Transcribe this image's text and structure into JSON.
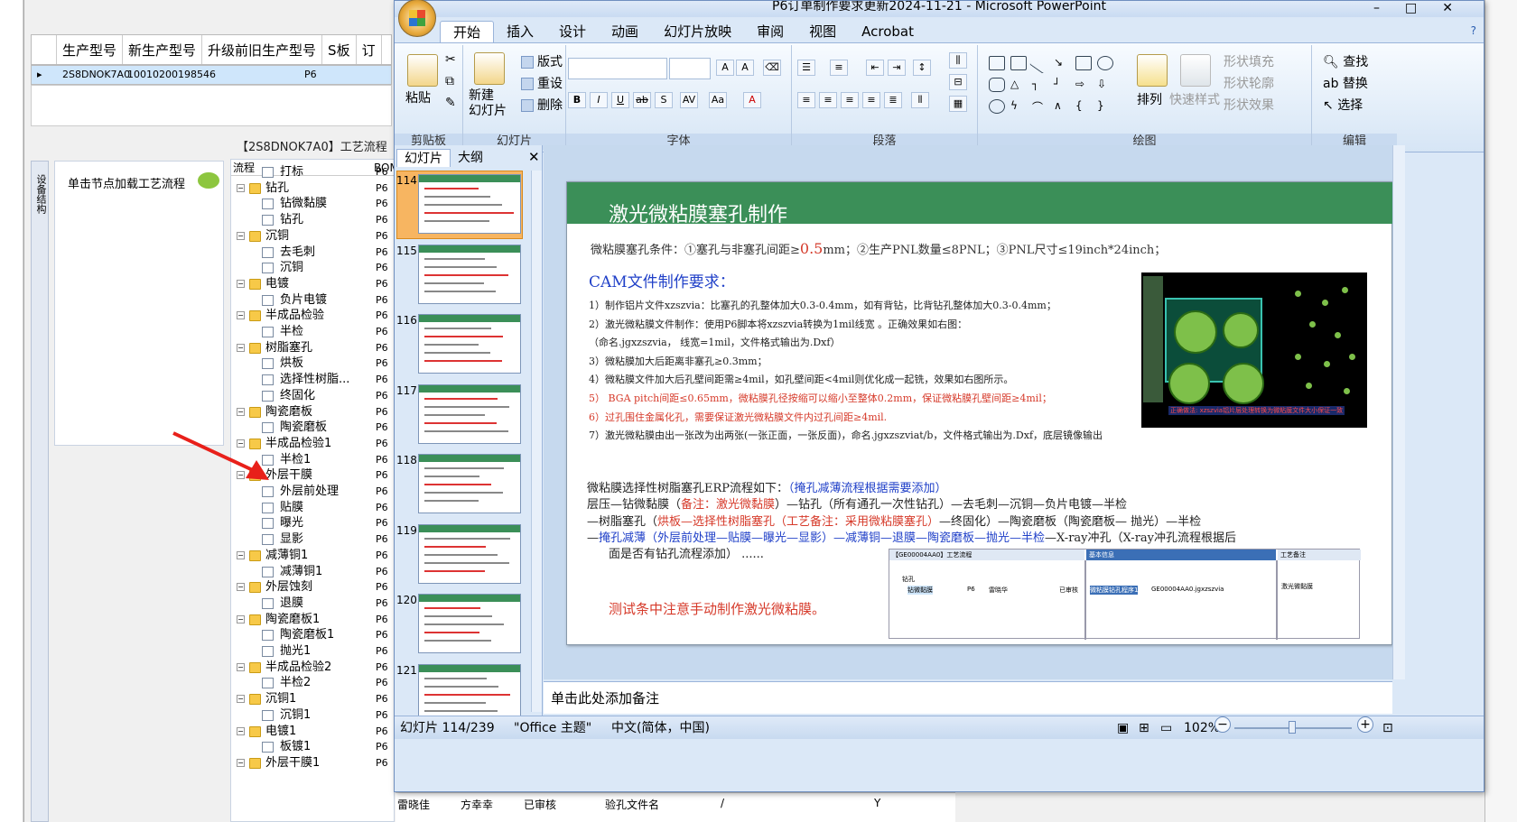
{
  "bg_app": {
    "columns": [
      "生产型号",
      "新生产型号",
      "升级前旧生产型号",
      "S板",
      "订"
    ],
    "row": {
      "col1": "2S8DNOK7A0",
      "col2": "10010200198546",
      "col3": "P6"
    },
    "tab_caption": "【2S8DNOK7A0】工艺流程",
    "vertical_tab": "设备结构",
    "hint": "单击节点加载工艺流程",
    "tree_header": {
      "flow": "流程",
      "col2": "BOM"
    },
    "tree": [
      {
        "label": "打标",
        "level": 2,
        "type": "file"
      },
      {
        "label": "钻孔",
        "level": 1,
        "type": "folder"
      },
      {
        "label": "钻微黏膜",
        "level": 2,
        "type": "file"
      },
      {
        "label": "钻孔",
        "level": 2,
        "type": "file"
      },
      {
        "label": "沉铜",
        "level": 1,
        "type": "folder"
      },
      {
        "label": "去毛刺",
        "level": 2,
        "type": "file"
      },
      {
        "label": "沉铜",
        "level": 2,
        "type": "file"
      },
      {
        "label": "电镀",
        "level": 1,
        "type": "folder"
      },
      {
        "label": "负片电镀",
        "level": 2,
        "type": "file"
      },
      {
        "label": "半成品检验",
        "level": 1,
        "type": "folder"
      },
      {
        "label": "半检",
        "level": 2,
        "type": "file"
      },
      {
        "label": "树脂塞孔",
        "level": 1,
        "type": "folder"
      },
      {
        "label": "烘板",
        "level": 2,
        "type": "file"
      },
      {
        "label": "选择性树脂...",
        "level": 2,
        "type": "file"
      },
      {
        "label": "终固化",
        "level": 2,
        "type": "file"
      },
      {
        "label": "陶瓷磨板",
        "level": 1,
        "type": "folder"
      },
      {
        "label": "陶瓷磨板",
        "level": 2,
        "type": "file"
      },
      {
        "label": "半成品检验1",
        "level": 1,
        "type": "folder"
      },
      {
        "label": "半检1",
        "level": 2,
        "type": "file"
      },
      {
        "label": "外层干膜",
        "level": 1,
        "type": "folder"
      },
      {
        "label": "外层前处理",
        "level": 2,
        "type": "file"
      },
      {
        "label": "贴膜",
        "level": 2,
        "type": "file"
      },
      {
        "label": "曝光",
        "level": 2,
        "type": "file"
      },
      {
        "label": "显影",
        "level": 2,
        "type": "file"
      },
      {
        "label": "减薄铜1",
        "level": 1,
        "type": "folder"
      },
      {
        "label": "减薄铜1",
        "level": 2,
        "type": "file"
      },
      {
        "label": "外层蚀刻",
        "level": 1,
        "type": "folder"
      },
      {
        "label": "退膜",
        "level": 2,
        "type": "file"
      },
      {
        "label": "陶瓷磨板1",
        "level": 1,
        "type": "folder"
      },
      {
        "label": "陶瓷磨板1",
        "level": 2,
        "type": "file"
      },
      {
        "label": "抛光1",
        "level": 2,
        "type": "file"
      },
      {
        "label": "半成品检验2",
        "level": 1,
        "type": "folder"
      },
      {
        "label": "半检2",
        "level": 2,
        "type": "file"
      },
      {
        "label": "沉铜1",
        "level": 1,
        "type": "folder"
      },
      {
        "label": "沉铜1",
        "level": 2,
        "type": "file"
      },
      {
        "label": "电镀1",
        "level": 1,
        "type": "folder"
      },
      {
        "label": "板镀1",
        "level": 2,
        "type": "file"
      },
      {
        "label": "外层干膜1",
        "level": 1,
        "type": "folder"
      }
    ],
    "tree_p6": "P6",
    "bottom": {
      "a": "雷晓佳",
      "b": "方幸幸",
      "c": "已审核",
      "d": "验孔文件名",
      "e": "/",
      "f": "Y"
    }
  },
  "ppt": {
    "title": "P6订单制作要求更新2024-11-21 - Microsoft PowerPoint",
    "menu": [
      "开始",
      "插入",
      "设计",
      "动画",
      "幻灯片放映",
      "审阅",
      "视图",
      "Acrobat"
    ],
    "groups": {
      "clipboard": "剪贴板",
      "slides": "幻灯片",
      "font": "字体",
      "paragraph": "段落",
      "drawing": "绘图",
      "edit": "编辑"
    },
    "buttons": {
      "paste": "粘贴",
      "new_slide": "新建\n幻灯片",
      "layout": "版式",
      "reset": "重设",
      "delete": "删除",
      "arrange": "排列",
      "quick_styles": "快速样式",
      "shape_fill": "形状填充",
      "shape_outline": "形状轮廓",
      "shape_effect": "形状效果",
      "find": "查找",
      "replace": "替换",
      "select": "选择"
    },
    "pane_tabs": [
      "幻灯片",
      "大纲"
    ],
    "thumb_numbers": [
      "114",
      "115",
      "116",
      "117",
      "118",
      "119",
      "120",
      "121"
    ],
    "selected_slide": "114",
    "notes_placeholder": "单击此处添加备注",
    "status": {
      "slide": "幻灯片 114/239",
      "theme": "\"Office 主题\"",
      "lang": "中文(简体，中国)",
      "zoom": "102%"
    }
  },
  "slide": {
    "title": "激光微粘膜塞孔制作",
    "cond_prefix": "微粘膜塞孔条件：①塞孔与非塞孔间距≥",
    "cond_value": "0.5",
    "cond_suffix": "mm；②生产PNL数量≤8PNL；③PNL尺寸≤19inch*24inch；",
    "cam_title": "CAM文件制作要求：",
    "steps": [
      {
        "text": "1）制作铝片文件xzszvia：比塞孔的孔整体加大0.3-0.4mm，如有背钻，比背钻孔整体加大0.3-0.4mm；",
        "red": false
      },
      {
        "text": "2）激光微粘膜文件制作：使用P6脚本将xzszvia转换为1mil线宽 。正确效果如右图：",
        "red": false
      },
      {
        "text": "（命名.jgxzszvia， 线宽=1mil，文件格式输出为.Dxf）",
        "red": false
      },
      {
        "text": "3）微粘膜加大后距离非塞孔≥0.3mm；",
        "red": false
      },
      {
        "text": "4）微粘膜文件加大后孔壁间距需≥4mil，如孔壁间距<4mil则优化成一起铣，效果如右图所示。",
        "red": false
      },
      {
        "text": "5） BGA pitch间距≤0.65mm，微粘膜孔径按缩可以缩小至整体0.2mm，保证微粘膜孔壁间距≥4mil；",
        "red": true
      },
      {
        "text": "6）过孔围住金属化孔，需要保证激光微粘膜文件内过孔间距≥4mil.",
        "red": true
      },
      {
        "text": "7）激光微粘膜由出一张改为出两张(一张正面，一张反面)，命名.jgxzszviat/b，文件格式输出为.Dxf，底层镜像输出",
        "red": false
      }
    ],
    "cad_caption": "正确做法: xzszvia铝片层处理转换为微粘膜文件大小保证一致",
    "flow1_a": "微粘膜选择性树脂塞孔ERP流程如下：",
    "flow1_b": "（掩孔减薄流程根据需要添加）",
    "flow2_a": "层压—钻微黏膜（",
    "flow2_b": "备注：激光微黏膜",
    "flow2_c": "）—钻孔（所有通孔一次性钻孔）—去毛刺—沉铜—负片电镀—半检",
    "flow3_a": "—树脂塞孔（",
    "flow3_b": "烘板—选择性树脂塞孔（工艺备注：采用微粘膜塞孔）",
    "flow3_c": "—终固化）—陶瓷磨板（陶瓷磨板— 抛光）—半检",
    "flow4_a": "—",
    "flow4_b": "掩孔减薄（外层前处理—贴膜—曝光—显影）—减薄铜—退膜—陶瓷磨板—抛光—半检",
    "flow4_c": "—X-ray冲孔（X-ray冲孔流程根据后",
    "flow5": "面是否有钻孔流程添加） ......",
    "tip": "测试条中注意手动制作激光微粘膜。",
    "erp": {
      "t1": "【GE00004AA0】工艺流程",
      "t2": "基本信息",
      "t3": "工艺备注",
      "r1": "钻孔",
      "r2": "钻微黏膜",
      "c1": "P6",
      "c2": "雷晓华",
      "c3": "已审核",
      "p1": "微粘膜钻孔程序1",
      "p2": "GE00004AA0.jgxzszvia",
      "note": "激光微黏膜"
    }
  }
}
